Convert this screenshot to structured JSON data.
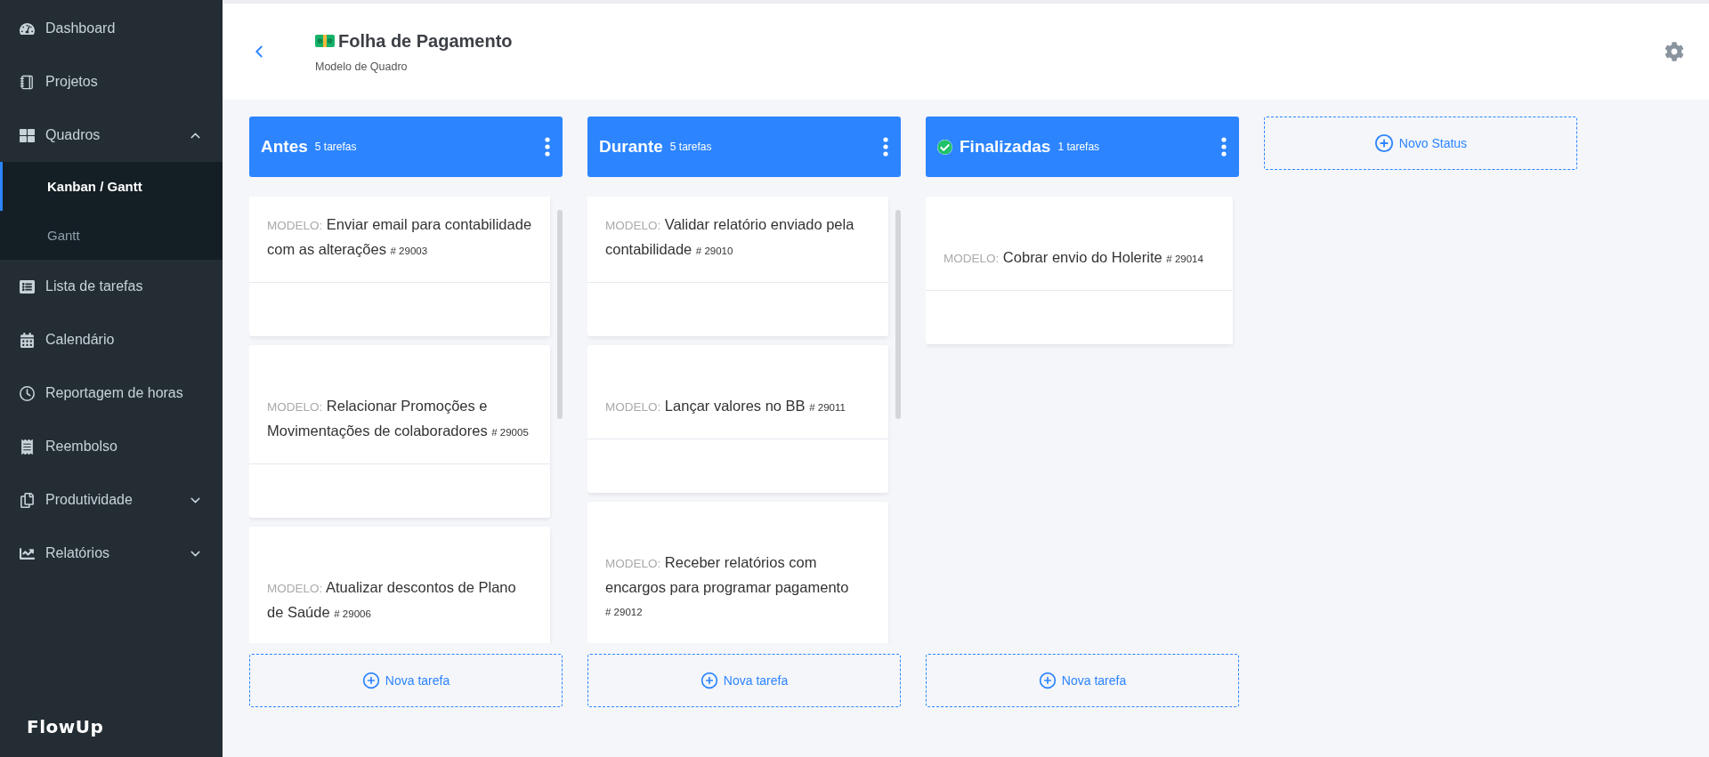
{
  "sidebar": {
    "items": [
      {
        "label": "Dashboard"
      },
      {
        "label": "Projetos"
      },
      {
        "label": "Quadros",
        "expanded": true,
        "children": [
          {
            "label": "Kanban / Gantt",
            "selected": true
          },
          {
            "label": "Gantt",
            "selected": false
          }
        ]
      },
      {
        "label": "Lista de tarefas"
      },
      {
        "label": "Calendário"
      },
      {
        "label": "Reportagem de horas"
      },
      {
        "label": "Reembolso"
      },
      {
        "label": "Produtividade",
        "expanded": false
      },
      {
        "label": "Relatórios",
        "expanded": false
      }
    ],
    "logo": "FlowUp"
  },
  "header": {
    "title": "Folha de Pagamento",
    "subtitle": "Modelo de Quadro"
  },
  "columns": [
    {
      "name": "Antes",
      "count": "5 tarefas",
      "done": false,
      "add_label": "Nova tarefa",
      "cards": [
        {
          "prefix": "MODELO:",
          "title": "Enviar email para contabilidade com as alterações",
          "number": "# 29003"
        },
        {
          "prefix": "MODELO:",
          "title": "Relacionar Promoções e Movimentações de colaboradores",
          "number": "# 29005"
        },
        {
          "prefix": "MODELO:",
          "title": "Atualizar descontos de Plano de Saúde",
          "number": "# 29006"
        }
      ]
    },
    {
      "name": "Durante",
      "count": "5 tarefas",
      "done": false,
      "add_label": "Nova tarefa",
      "cards": [
        {
          "prefix": "MODELO:",
          "title": "Validar relatório enviado pela contabilidade",
          "number": "# 29010"
        },
        {
          "prefix": "MODELO:",
          "title": "Lançar valores no BB",
          "number": "# 29011"
        },
        {
          "prefix": "MODELO:",
          "title": "Receber relatórios com encargos para programar pagamento",
          "number": "# 29012"
        }
      ]
    },
    {
      "name": "Finalizadas",
      "count": "1 tarefas",
      "done": true,
      "add_label": "Nova tarefa",
      "cards": [
        {
          "prefix": "MODELO:",
          "title": "Cobrar envio do Holerite",
          "number": "# 29014"
        }
      ]
    }
  ],
  "new_status": "Novo Status"
}
